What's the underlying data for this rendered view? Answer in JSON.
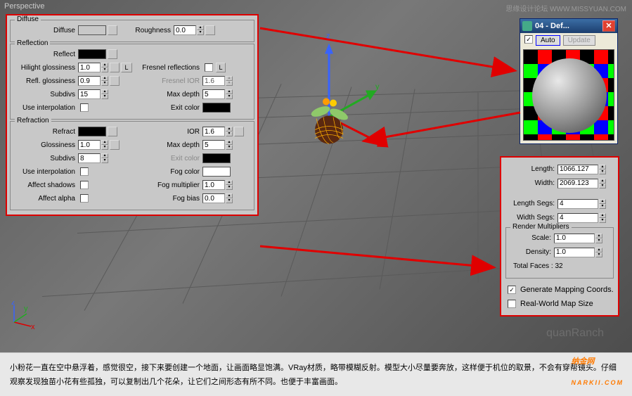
{
  "viewport": {
    "label": "Perspective",
    "watermark_top": "思缘设计论坛  WWW.MISSYUAN.COM",
    "ghost_text": "quanRanch"
  },
  "material": {
    "groups": {
      "diffuse": {
        "title": "Diffuse",
        "diffuse_label": "Diffuse",
        "roughness_label": "Roughness",
        "roughness_value": "0.0"
      },
      "reflection": {
        "title": "Reflection",
        "reflect_label": "Reflect",
        "hilight_gloss_label": "Hilight glossiness",
        "hilight_gloss_value": "1.0",
        "refl_gloss_label": "Refl. glossiness",
        "refl_gloss_value": "0.9",
        "subdivs_label": "Subdivs",
        "subdivs_value": "15",
        "use_interp_label": "Use interpolation",
        "l_btn": "L",
        "fresnel_label": "Fresnel reflections",
        "fresnel_ior_label": "Fresnel IOR",
        "fresnel_ior_value": "1.6",
        "max_depth_label": "Max depth",
        "max_depth_value": "5",
        "exit_color_label": "Exit color"
      },
      "refraction": {
        "title": "Refraction",
        "refract_label": "Refract",
        "glossiness_label": "Glossiness",
        "glossiness_value": "1.0",
        "subdivs_label": "Subdivs",
        "subdivs_value": "8",
        "use_interp_label": "Use interpolation",
        "affect_shadows_label": "Affect shadows",
        "affect_alpha_label": "Affect alpha",
        "ior_label": "IOR",
        "ior_value": "1.6",
        "max_depth_label": "Max depth",
        "max_depth_value": "5",
        "exit_color_label": "Exit color",
        "fog_color_label": "Fog color",
        "fog_mult_label": "Fog multiplier",
        "fog_mult_value": "1.0",
        "fog_bias_label": "Fog bias",
        "fog_bias_value": "0.0"
      }
    }
  },
  "preview": {
    "title": "04 - Def...",
    "auto_label": "Auto",
    "update_label": "Update"
  },
  "plane": {
    "length_label": "Length:",
    "length_value": "1066.127",
    "width_label": "Width:",
    "width_value": "2069.123",
    "length_segs_label": "Length Segs:",
    "length_segs_value": "4",
    "width_segs_label": "Width Segs:",
    "width_segs_value": "4",
    "render_mult_title": "Render Multipliers",
    "scale_label": "Scale:",
    "scale_value": "1.0",
    "density_label": "Density:",
    "density_value": "1.0",
    "total_faces_label": "Total Faces : 32",
    "gen_coords_label": "Generate Mapping Coords.",
    "real_world_label": "Real-World Map Size"
  },
  "caption": {
    "text": "小粉花一直在空中悬浮着，感觉很空，接下来要创建一个地面，让画面略显饱满。VRay材质，略带模糊反射。模型大小尽量要奔放，这样便于机位的取景，不会有穿帮镜头。仔细观察发现独苗小花有些孤独，可以复制出几个花朵，让它们之间形态有所不同。也便于丰富画面。",
    "logo_main": "纳金网",
    "logo_sub": "NARKII.COM"
  }
}
